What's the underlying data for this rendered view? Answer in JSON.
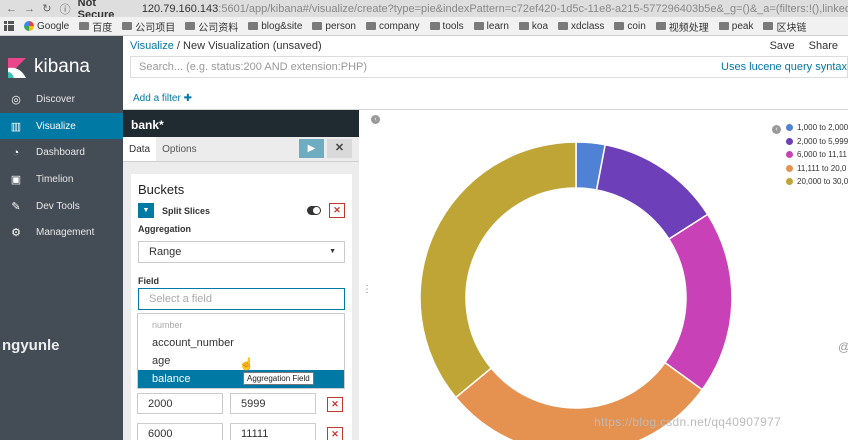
{
  "browser": {
    "security_label": "Not Secure",
    "url_host": "120.79.160.143",
    "url_path": ":5601/app/kibana#/visualize/create?type=pie&indexPattern=c72ef420-1d5c-11e8-a215-577296403b5e&_g=()&_a=(filters:!(),linked:!f,...",
    "bookmarks": [
      "Google",
      "百度",
      "公司项目",
      "公司资料",
      "blog&site",
      "person",
      "company",
      "tools",
      "learn",
      "koa",
      "xdclass",
      "coin",
      "视频处理",
      "peak",
      "区块链"
    ]
  },
  "app": {
    "logo_text": "kibana",
    "nav": [
      {
        "label": "Discover",
        "icon": "compass-icon"
      },
      {
        "label": "Visualize",
        "icon": "bar-chart-icon"
      },
      {
        "label": "Dashboard",
        "icon": "dashboard-icon"
      },
      {
        "label": "Timelion",
        "icon": "timelion-icon"
      },
      {
        "label": "Dev Tools",
        "icon": "wrench-icon"
      },
      {
        "label": "Management",
        "icon": "gear-icon"
      }
    ],
    "active_nav": "Visualize"
  },
  "watermark_left": "ngyunle",
  "breadcrumb": {
    "link": "Visualize",
    "separator": "/",
    "current": "New Visualization (unsaved)"
  },
  "top_actions": {
    "save": "Save",
    "share": "Share"
  },
  "search": {
    "placeholder": "Search... (e.g. status:200 AND extension:PHP)",
    "syntax_link": "Uses lucene query syntax"
  },
  "add_filter": "Add a filter ✚",
  "editor": {
    "index_pattern": "bank*",
    "tabs": [
      "Data",
      "Options"
    ],
    "active_tab": "Data",
    "buckets_title": "Buckets",
    "split_label": "Split Slices",
    "aggregation_label": "Aggregation",
    "aggregation_value": "Range",
    "field_label": "Field",
    "field_placeholder": "Select a field",
    "dropdown_group": "number",
    "dropdown_items": [
      "account_number",
      "age",
      "balance"
    ],
    "dropdown_selected": "balance",
    "tooltip": "Aggregation Field",
    "ranges": [
      {
        "from": "2000",
        "to": "5999"
      },
      {
        "from": "6000",
        "to": "11111"
      }
    ]
  },
  "chart_data": {
    "type": "pie",
    "donut": true,
    "categories": [
      "1,000 to 2,000",
      "2,000 to 5,999",
      "6,000 to 11,11",
      "11,111 to 20,0",
      "20,000 to 30,0"
    ],
    "values": [
      3,
      13,
      19,
      29,
      36
    ],
    "colors": [
      "#4f82d4",
      "#6d3fb8",
      "#c941b7",
      "#e5914f",
      "#bfa536"
    ],
    "legend": "right"
  },
  "watermark_right": "https://blog.csdn.net/qq40907977"
}
